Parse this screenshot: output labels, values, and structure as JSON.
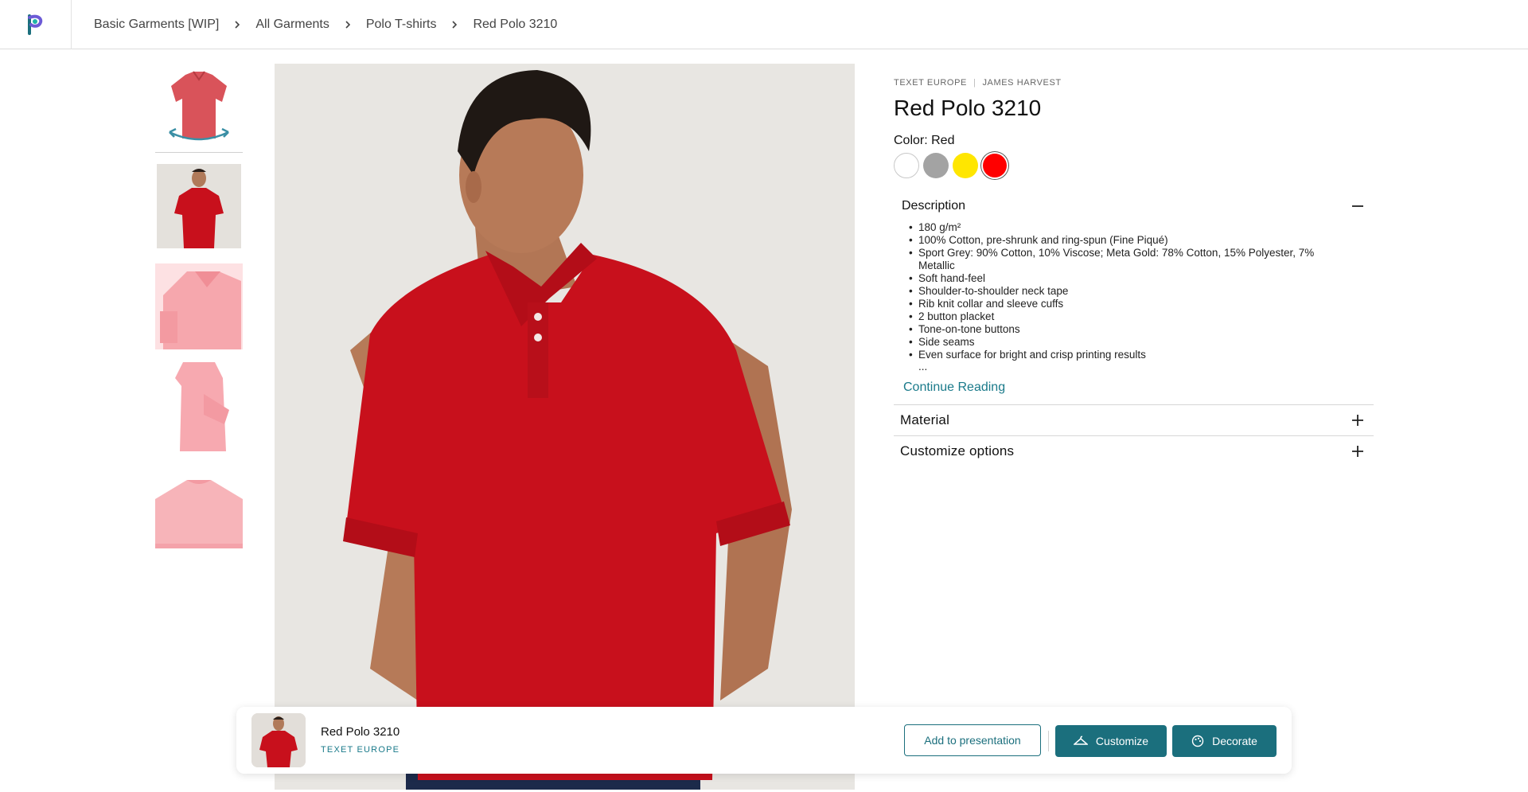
{
  "header": {
    "logo_icon": "brand-logo-icon",
    "breadcrumb": [
      {
        "label": "Basic Garments [WIP]"
      },
      {
        "label": "All Garments"
      },
      {
        "label": "Polo T-shirts"
      },
      {
        "label": "Red Polo 3210"
      }
    ]
  },
  "gallery": {
    "thumbnails": [
      "360-view",
      "front-model",
      "collar-detail",
      "sleeve-side",
      "back-view"
    ],
    "main_image": "model-wearing-red-polo"
  },
  "product": {
    "brand": "TEXET EUROPE",
    "sub_brand": "JAMES HARVEST",
    "title": "Red Polo 3210",
    "color_label": "Color: Red",
    "colors": [
      {
        "name": "White",
        "hex": "#ffffff"
      },
      {
        "name": "Grey",
        "hex": "#a3a3a3"
      },
      {
        "name": "Yellow",
        "hex": "#ffe600"
      },
      {
        "name": "Red",
        "hex": "#ff0000",
        "selected": true
      }
    ]
  },
  "description": {
    "heading": "Description",
    "items": [
      "180 g/m²",
      "100% Cotton, pre-shrunk and ring-spun (Fine Piqué)",
      "Sport Grey: 90% Cotton, 10% Viscose; Meta Gold: 78% Cotton, 15% Polyester, 7% Metallic",
      "Soft hand-feel",
      "Shoulder-to-shoulder neck tape",
      "Rib knit collar and sleeve cuffs",
      "2 button placket",
      "Tone-on-tone buttons",
      "Side seams",
      "Even surface for bright and crisp printing results"
    ],
    "ellipsis": "...",
    "continue_label": "Continue Reading"
  },
  "accordions": {
    "material": "Material",
    "customize": "Customize options"
  },
  "action_bar": {
    "product_name": "Red Polo 3210",
    "brand": "TEXET EUROPE",
    "add_to_presentation": "Add to presentation",
    "customize": "Customize",
    "decorate": "Decorate"
  },
  "colors": {
    "accent": "#1b6f7d",
    "link": "#1a7a8a",
    "polo_red": "#c8101c"
  }
}
